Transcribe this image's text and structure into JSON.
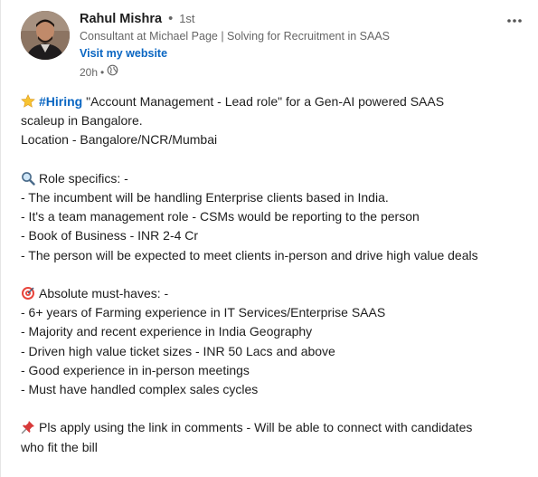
{
  "author": {
    "name": "Rahul Mishra",
    "degree": "1st",
    "headline": "Consultant at Michael Page | Solving for Recruitment in SAAS",
    "website_link": "Visit my website",
    "time": "20h",
    "dot": "•"
  },
  "post": {
    "line1_hashtag": "#Hiring",
    "line1_rest": " \"Account Management - Lead role\" for a Gen-AI powered SAAS",
    "line2": "scaleup in Bangalore.",
    "line3": "Location - Bangalore/NCR/Mumbai",
    "role_heading": "Role specifics: -",
    "role_items": [
      "- The incumbent will be handling Enterprise clients based in India.",
      "- It's a team management role - CSMs would be reporting to the person",
      "- Book of Business - INR 2-4 Cr",
      "- The person will be expected to meet clients in-person and drive high value deals"
    ],
    "must_heading": "Absolute must-haves: -",
    "must_items": [
      "- 6+ years of Farming experience in IT Services/Enterprise SAAS",
      "- Majority and recent experience in India Geography",
      "- Driven high value ticket sizes - INR 50 Lacs and above",
      "- Good experience in in-person meetings",
      "- Must have handled complex sales cycles"
    ],
    "apply_line1": "Pls apply using the link in comments - Will be able to connect with candidates",
    "apply_line2": "who fit the bill"
  },
  "icons": {
    "star": "star-icon",
    "search": "magnifier-icon",
    "target": "target-icon",
    "pin": "pushpin-icon",
    "globe": "globe-icon",
    "more": "more-options-icon"
  },
  "colors": {
    "link": "#0a66c2",
    "muted": "#666666",
    "text": "#1d1d1d"
  }
}
